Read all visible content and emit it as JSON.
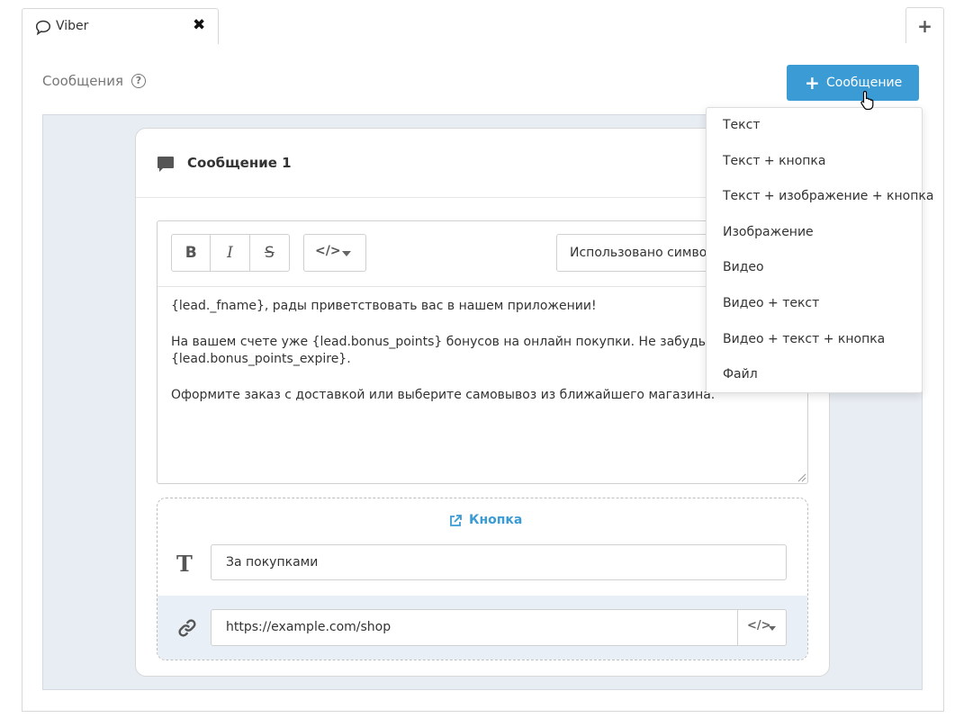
{
  "tabs": {
    "active": {
      "label": "Viber",
      "icon": "chat-bubble-icon",
      "close_icon": "close-icon"
    },
    "add_icon": "plus-icon"
  },
  "section": {
    "title": "Сообщения",
    "help_icon": "question-circle-icon"
  },
  "add_button": {
    "label": "Сообщение",
    "icon": "plus-icon",
    "color": "#3a9bd5"
  },
  "dropdown": {
    "items": [
      "Текст",
      "Текст + кнопка",
      "Текст + изображение + кнопка",
      "Изображение",
      "Видео",
      "Видео + текст",
      "Видео + текст + кнопка",
      "Файл"
    ]
  },
  "message": {
    "title": "Сообщение 1",
    "icon": "message-icon",
    "toolbar": {
      "bold": "B",
      "italic": "I",
      "strike": "S",
      "code_icon": "</>",
      "char_count": "Использовано символов"
    },
    "body_lines": [
      "{lead._fname}, рады приветствовать вас в нашем приложении!",
      "На вашем счете уже {lead.bonus_points} бонусов на онлайн покупки. Не забудьте испольвы",
      "{lead.bonus_points_expire}.",
      "Оформите заказ с доставкой или выберите самовывоз из ближайшего магазина."
    ],
    "button_block": {
      "title": "Кнопка",
      "title_icon": "external-link-icon",
      "text_icon": "text-icon",
      "text_value": "За покупками",
      "link_icon": "link-icon",
      "url_value": "https://example.com/shop",
      "url_code_icon": "</>"
    }
  },
  "colors": {
    "accent": "#3a9bd5",
    "grey_area": "#e8edf3",
    "link_row": "#e9eff7"
  }
}
